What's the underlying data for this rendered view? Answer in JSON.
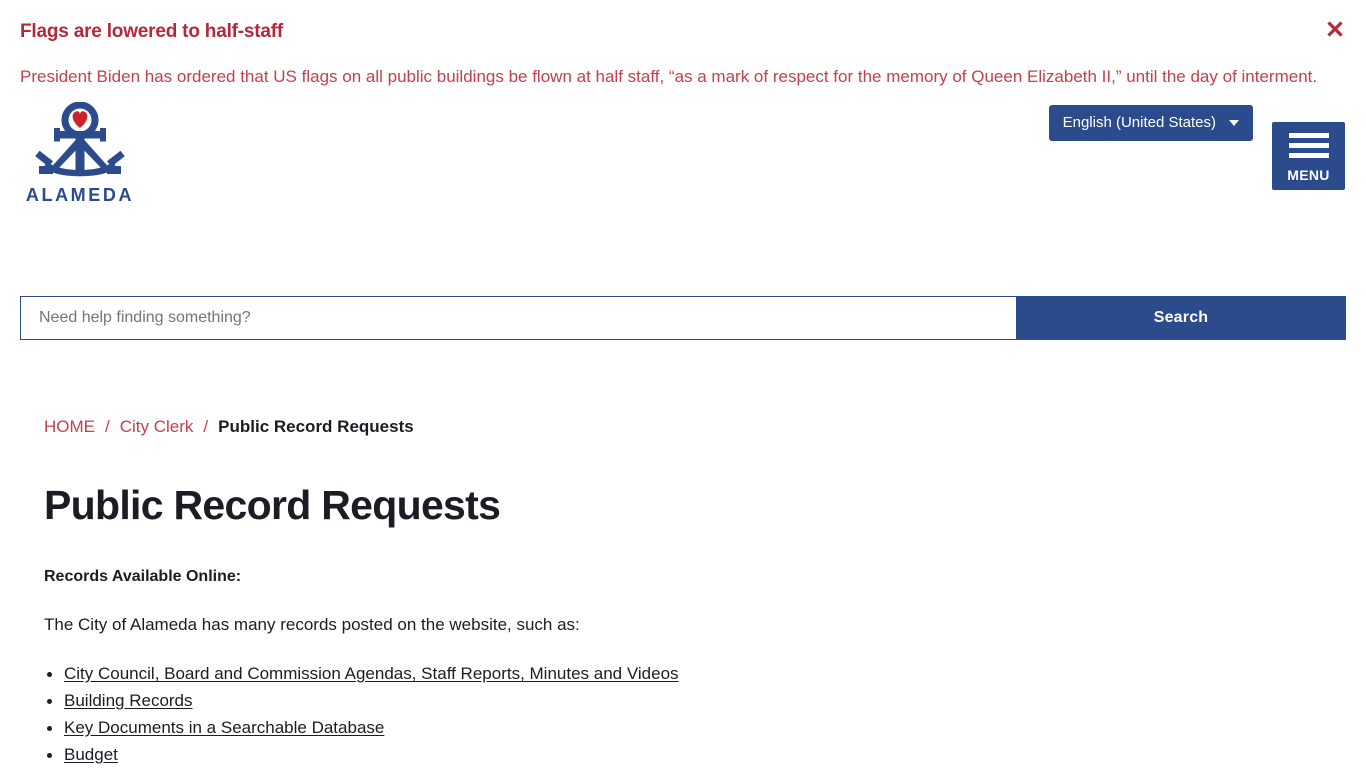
{
  "alert": {
    "title": "Flags are lowered to half-staff",
    "body": "President Biden has ordered that US flags on all public buildings be flown at half staff, “as a mark of respect for the memory of Queen Elizabeth II,” until the day of interment.",
    "close_icon": "close-icon",
    "title_color": "#b4293a",
    "body_color": "#c2414c"
  },
  "header": {
    "language_label": "English (United States)",
    "language_caret_icon": "chevron-down-icon",
    "logo_wordmark": "ALAMEDA",
    "logo_icon": "anchor-heart-logo-icon",
    "menu_label": "MENU",
    "menu_icon": "hamburger-icon",
    "brand_navy": "#2b4b8c"
  },
  "search": {
    "placeholder": "Need help finding something?",
    "value": "",
    "button_label": "Search"
  },
  "breadcrumb": {
    "items": [
      {
        "label": "HOME",
        "current": false
      },
      {
        "label": "City Clerk",
        "current": false
      },
      {
        "label": "Public Record Requests",
        "current": true
      }
    ],
    "separator": "/"
  },
  "main": {
    "title": "Public Record Requests",
    "lead": "Records Available Online:",
    "intro": "The City of Alameda has many records posted on the website, such as:",
    "links": [
      "City Council, Board and Commission Agendas, Staff Reports, Minutes and Videos",
      "Building Records",
      "Key Documents in a Searchable Database",
      "Budget"
    ]
  }
}
